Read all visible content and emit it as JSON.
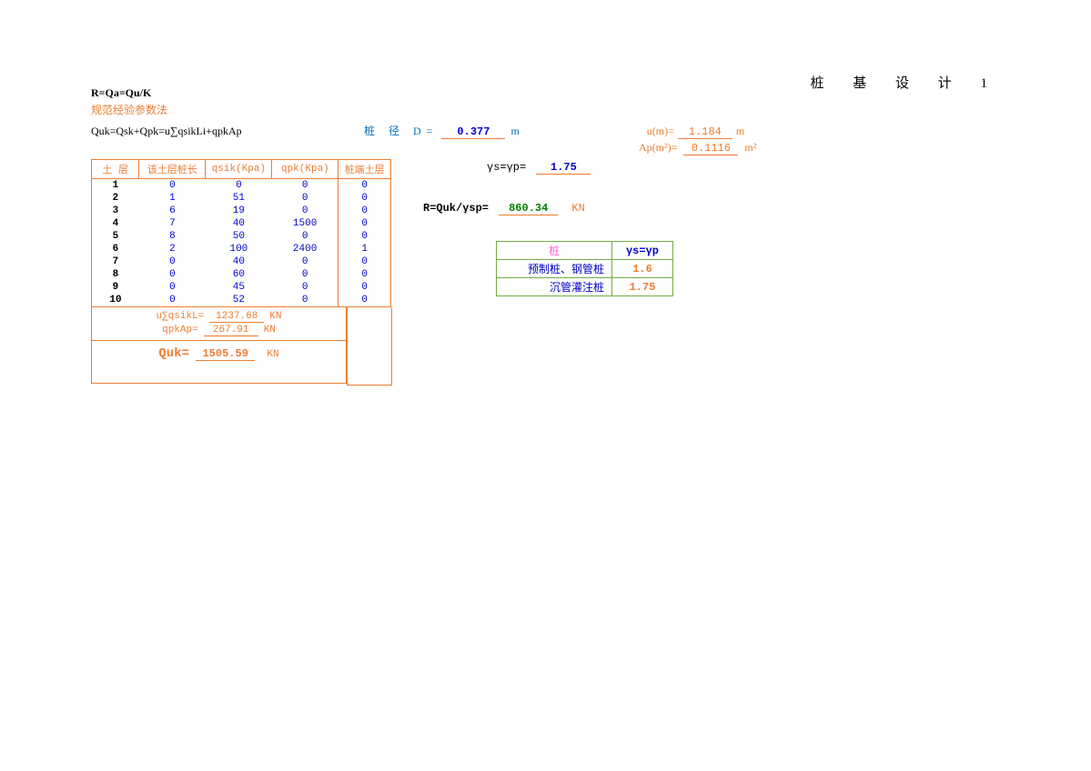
{
  "page_title": "桩  基  设  计 1",
  "header": {
    "formula1": "R=Qa=Qu/K",
    "subtitle": "规范经验参数法",
    "formula2": "Quk=Qsk+Qpk=u∑qsikLi+qpkAp",
    "d_label": "桩  径 D=",
    "d_value": "0.377",
    "d_unit": "m",
    "u_label": "u(m)=",
    "u_value": "1.184",
    "u_unit": "m",
    "ap_label": "Ap(m²)=",
    "ap_value": "0.1116",
    "ap_unit": "m²"
  },
  "table_headers": {
    "h1": "土     层",
    "h2": "该土层桩长",
    "h3": "qsik(Kpa)",
    "h4": "qpk(Kpa)",
    "h5": "桩端土层"
  },
  "soil_rows": [
    {
      "idx": "1",
      "len": "0",
      "qsik": "0",
      "qpk": "0",
      "end": "0"
    },
    {
      "idx": "2",
      "len": "1",
      "qsik": "51",
      "qpk": "0",
      "end": "0"
    },
    {
      "idx": "3",
      "len": "6",
      "qsik": "19",
      "qpk": "0",
      "end": "0"
    },
    {
      "idx": "4",
      "len": "7",
      "qsik": "40",
      "qpk": "1500",
      "end": "0"
    },
    {
      "idx": "5",
      "len": "8",
      "qsik": "50",
      "qpk": "0",
      "end": "0"
    },
    {
      "idx": "6",
      "len": "2",
      "qsik": "100",
      "qpk": "2400",
      "end": "1"
    },
    {
      "idx": "7",
      "len": "0",
      "qsik": "40",
      "qpk": "0",
      "end": "0"
    },
    {
      "idx": "8",
      "len": "0",
      "qsik": "60",
      "qpk": "0",
      "end": "0"
    },
    {
      "idx": "9",
      "len": "0",
      "qsik": "45",
      "qpk": "0",
      "end": "0"
    },
    {
      "idx": "10",
      "len": "0",
      "qsik": "52",
      "qpk": "0",
      "end": "0"
    }
  ],
  "sums": {
    "s1_label": "u∑qsikL=",
    "s1_value": "1237.68",
    "s1_unit": "KN",
    "s2_label": "qpkAp=",
    "s2_value": "267.91",
    "s2_unit": "KN",
    "quk_label": "Quk=",
    "quk_value": "1505.59",
    "quk_unit": "KN"
  },
  "gamma": {
    "label": "γs=γp=",
    "value": "1.75"
  },
  "result": {
    "label": "R=Quk/γsp=",
    "value": "860.34",
    "unit": "KN"
  },
  "pile_types": {
    "h1": "桩",
    "h2": "γs=γp",
    "rows": [
      {
        "name": "预制桩、钢管桩",
        "val": "1.6"
      },
      {
        "name": "沉管灌注桩",
        "val": "1.75"
      }
    ]
  }
}
